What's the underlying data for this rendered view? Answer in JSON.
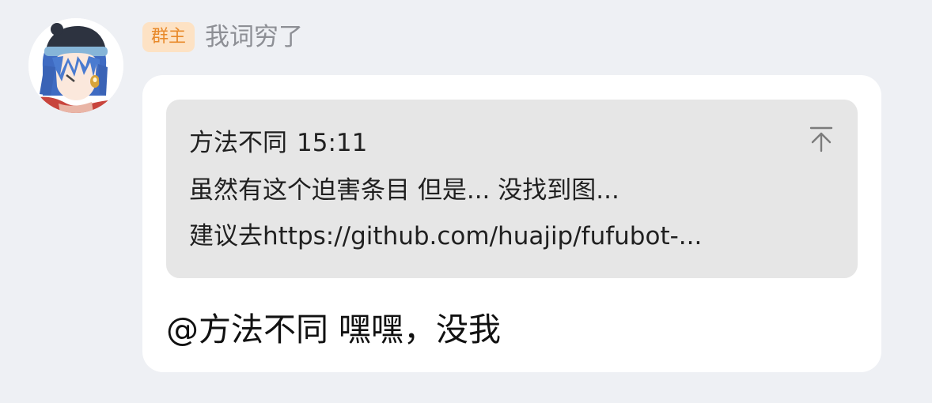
{
  "message": {
    "sender": {
      "role_badge": "群主",
      "name": "我词穷了",
      "avatar_icon": "anime-avatar-icon"
    },
    "quote": {
      "author": "方法不同",
      "time": "15:11",
      "lines": [
        "虽然有这个迫害条目 但是... 没找到图...",
        "建议去https://github.com/huajip/fufubot-..."
      ],
      "jump_icon": "scroll-to-original-icon"
    },
    "text": "@方法不同 嘿嘿，没我"
  },
  "colors": {
    "background": "#eef0f4",
    "bubble": "#ffffff",
    "quote_background": "#e6e6e6",
    "badge_background": "#fde2c4",
    "badge_text": "#e8892a",
    "name_text": "#8d8f95"
  }
}
